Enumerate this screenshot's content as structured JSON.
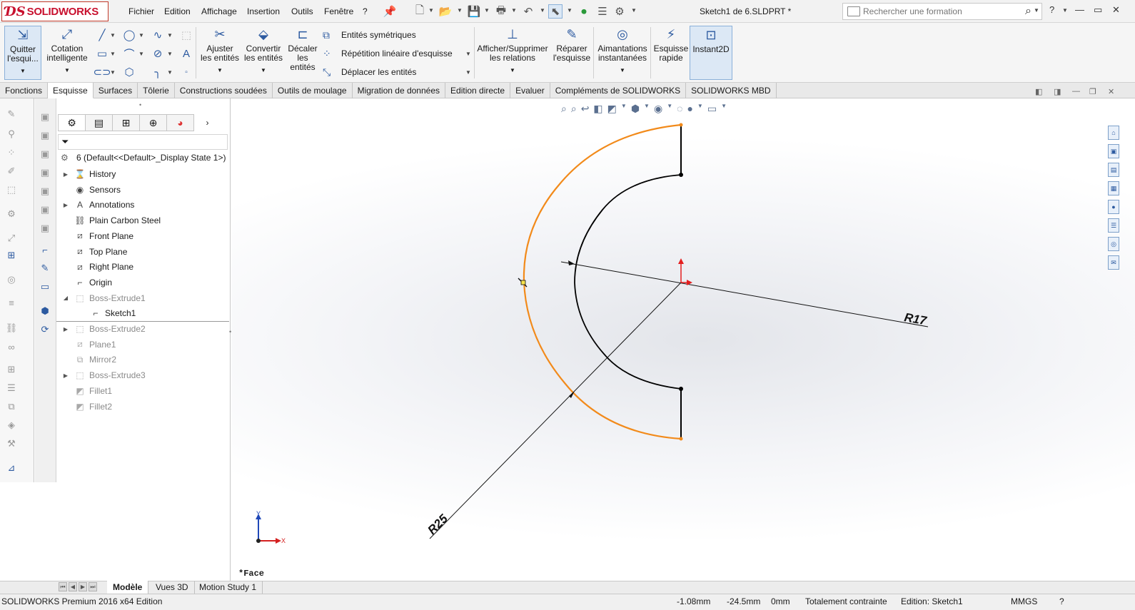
{
  "app": {
    "brand": "SOLIDWORKS",
    "document_title": "Sketch1 de 6.SLDPRT *"
  },
  "menu": [
    "Fichier",
    "Edition",
    "Affichage",
    "Insertion",
    "Outils",
    "Fenêtre",
    "?"
  ],
  "search": {
    "placeholder": "Rechercher une formation"
  },
  "help_label": "?",
  "commands": {
    "exit_sketch": "Quitter l'esqui...",
    "smart_dimension": "Cotation intelligente",
    "trim": "Ajuster les entités",
    "convert": "Convertir les entités",
    "offset": "Décaler les entités",
    "mirror": "Entités symétriques",
    "linear_pattern": "Répétition linéaire d'esquisse",
    "move": "Déplacer les entités",
    "relations": "Afficher/Supprimer les relations",
    "repair": "Réparer l'esquisse",
    "snaps": "Aimantations instantanées",
    "quick_sketch": "Esquisse rapide",
    "instant2d": "Instant2D"
  },
  "tabs": [
    {
      "label": "Fonctions",
      "active": false
    },
    {
      "label": "Esquisse",
      "active": true
    },
    {
      "label": "Surfaces",
      "active": false
    },
    {
      "label": "Tôlerie",
      "active": false
    },
    {
      "label": "Constructions soudées",
      "active": false
    },
    {
      "label": "Outils de moulage",
      "active": false
    },
    {
      "label": "Migration de données",
      "active": false
    },
    {
      "label": "Edition directe",
      "active": false
    },
    {
      "label": "Evaluer",
      "active": false
    },
    {
      "label": "Compléments de SOLIDWORKS",
      "active": false
    },
    {
      "label": "SOLIDWORKS MBD",
      "active": false
    }
  ],
  "feature_tree": {
    "root": "6  (Default<<Default>_Display State 1>)",
    "items": [
      {
        "label": "History",
        "icon": "history-icon",
        "arrow": true,
        "dim": false
      },
      {
        "label": "Sensors",
        "icon": "sensor-icon",
        "arrow": false,
        "dim": false
      },
      {
        "label": "Annotations",
        "icon": "annotation-icon",
        "arrow": true,
        "dim": false
      },
      {
        "label": "Plain Carbon Steel",
        "icon": "material-icon",
        "arrow": false,
        "dim": false
      },
      {
        "label": "Front Plane",
        "icon": "plane-icon",
        "arrow": false,
        "dim": false
      },
      {
        "label": "Top Plane",
        "icon": "plane-icon",
        "arrow": false,
        "dim": false
      },
      {
        "label": "Right Plane",
        "icon": "plane-icon",
        "arrow": false,
        "dim": false
      },
      {
        "label": "Origin",
        "icon": "origin-icon",
        "arrow": false,
        "dim": false
      },
      {
        "label": "Boss-Extrude1",
        "icon": "extrude-icon",
        "arrow": "open",
        "dim": true
      },
      {
        "label": "Sketch1",
        "icon": "sketch-icon",
        "arrow": false,
        "dim": false,
        "child": true
      },
      {
        "label": "Boss-Extrude2",
        "icon": "extrude-icon",
        "arrow": true,
        "dim": true
      },
      {
        "label": "Plane1",
        "icon": "plane-icon",
        "arrow": false,
        "dim": true
      },
      {
        "label": "Mirror2",
        "icon": "mirror-icon",
        "arrow": false,
        "dim": true
      },
      {
        "label": "Boss-Extrude3",
        "icon": "extrude-icon",
        "arrow": true,
        "dim": true
      },
      {
        "label": "Fillet1",
        "icon": "fillet-icon",
        "arrow": false,
        "dim": true
      },
      {
        "label": "Fillet2",
        "icon": "fillet-icon",
        "arrow": false,
        "dim": true
      }
    ]
  },
  "viewport": {
    "dimension_outer": "R25",
    "dimension_inner": "R17",
    "triad_y": "Y",
    "triad_x": "X",
    "view_label": "*Face",
    "colors": {
      "selected": "#f28a1a",
      "sketch": "#000000",
      "origin": "#e41f1f"
    }
  },
  "bottom_tabs": [
    {
      "label": "Modèle",
      "active": true
    },
    {
      "label": "Vues 3D",
      "active": false
    },
    {
      "label": "Motion Study 1",
      "active": false
    }
  ],
  "status": {
    "product": "SOLIDWORKS Premium 2016 x64 Edition",
    "x": "-1.08mm",
    "y": "-24.5mm",
    "z": "0mm",
    "state": "Totalement contrainte",
    "editing": "Edition: Sketch1",
    "units": "MMGS",
    "help": "?"
  }
}
